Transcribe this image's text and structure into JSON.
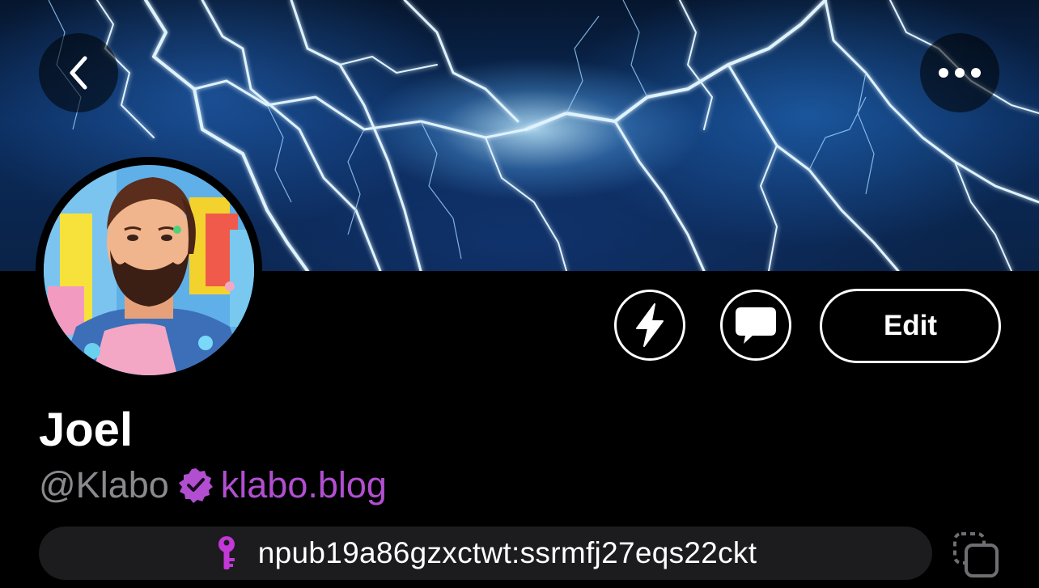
{
  "header": {
    "back_icon": "chevron-left-icon",
    "more_icon": "ellipsis-icon"
  },
  "profile": {
    "display_name": "Joel",
    "handle": "@Klabo",
    "nip05": "klabo.blog",
    "verified_icon": "verified-badge-icon",
    "npub": "npub19a86gzxctwt:ssrmfj27eqs22ckt",
    "key_icon": "key-icon"
  },
  "actions": {
    "zap_icon": "lightning-bolt-icon",
    "dm_icon": "chat-bubble-icon",
    "edit_label": "Edit",
    "copy_icon": "copy-icon"
  },
  "colors": {
    "background": "#000000",
    "accent": "#b14fd0",
    "handle": "#8a8a8e",
    "pill": "#1c1c1e"
  }
}
